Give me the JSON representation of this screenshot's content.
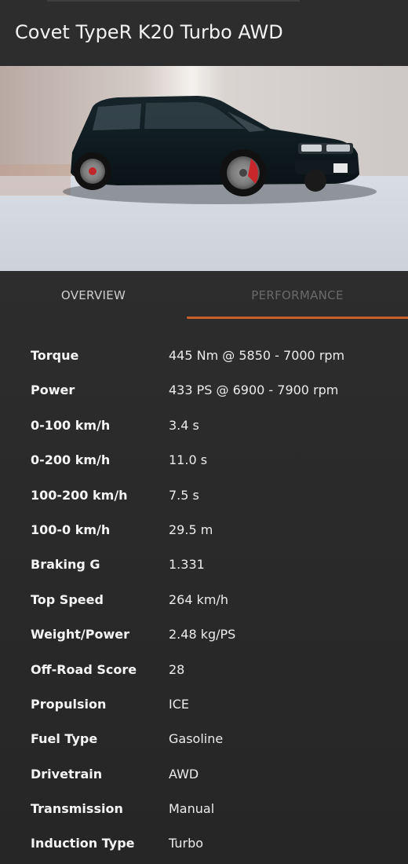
{
  "header": {
    "title": "Covet TypeR K20 Turbo AWD"
  },
  "photo": {
    "plate_text": "DHG 887"
  },
  "tabs": [
    {
      "label": "OVERVIEW",
      "active": false
    },
    {
      "label": "PERFORMANCE",
      "active": true
    }
  ],
  "accent_color": "#c8602a",
  "specs": [
    {
      "label": "Torque",
      "value": "445 Nm @ 5850 - 7000 rpm"
    },
    {
      "label": "Power",
      "value": "433 PS @ 6900 - 7900 rpm"
    },
    {
      "label": "0-100 km/h",
      "value": "3.4 s"
    },
    {
      "label": "0-200 km/h",
      "value": "11.0 s"
    },
    {
      "label": "100-200 km/h",
      "value": "7.5 s"
    },
    {
      "label": "100-0 km/h",
      "value": "29.5 m"
    },
    {
      "label": "Braking G",
      "value": "1.331"
    },
    {
      "label": "Top Speed",
      "value": "264 km/h"
    },
    {
      "label": "Weight/Power",
      "value": "2.48 kg/PS"
    },
    {
      "label": "Off-Road Score",
      "value": "28"
    },
    {
      "label": "Propulsion",
      "value": "ICE"
    },
    {
      "label": "Fuel Type",
      "value": "Gasoline"
    },
    {
      "label": "Drivetrain",
      "value": "AWD"
    },
    {
      "label": "Transmission",
      "value": "Manual"
    },
    {
      "label": "Induction Type",
      "value": "Turbo"
    }
  ]
}
